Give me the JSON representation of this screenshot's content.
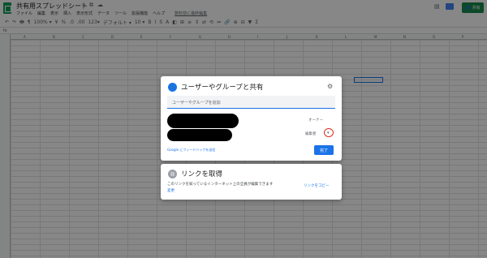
{
  "app": {
    "doc_title": "共有用スプレッドシート",
    "menus": [
      "ファイル",
      "編集",
      "表示",
      "挿入",
      "表示形式",
      "データ",
      "ツール",
      "拡張機能",
      "ヘルプ"
    ],
    "last_edit": "数秒前に最終編集",
    "share_label": "共有"
  },
  "toolbar": {
    "items": [
      "↶",
      "↷",
      "🖶",
      "¶",
      "100% ▾",
      "¥",
      "%",
      ".0",
      ".00",
      "123▾",
      "デフォルト ▾",
      "10 ▾",
      "B",
      "I",
      "S",
      "A",
      "◧",
      "⊞",
      "≡",
      "⇕",
      "⇄",
      "⟲",
      "⇔",
      "🔗",
      "⊕",
      "⊟",
      "▼",
      "Σ"
    ]
  },
  "grid": {
    "columns": [
      "A",
      "B",
      "C",
      "D",
      "E",
      "F",
      "G",
      "H",
      "I",
      "J",
      "K",
      "L",
      "M",
      "N",
      "O",
      "P"
    ]
  },
  "share_dialog": {
    "title": "ユーザーやグループと共有",
    "input_placeholder": "ユーザーやグループを追加",
    "owner_label": "オーナー",
    "role_label": "編集者",
    "dropdown_glyph": "▾",
    "feedback_link": "Google にフィードバックを送信",
    "done_label": "完了"
  },
  "link_dialog": {
    "title": "リンクを取得",
    "description": "このリンクを知っているインターネット上の全員が編集できます",
    "change_link": "変更",
    "copy_link": "リンクをコピー"
  }
}
